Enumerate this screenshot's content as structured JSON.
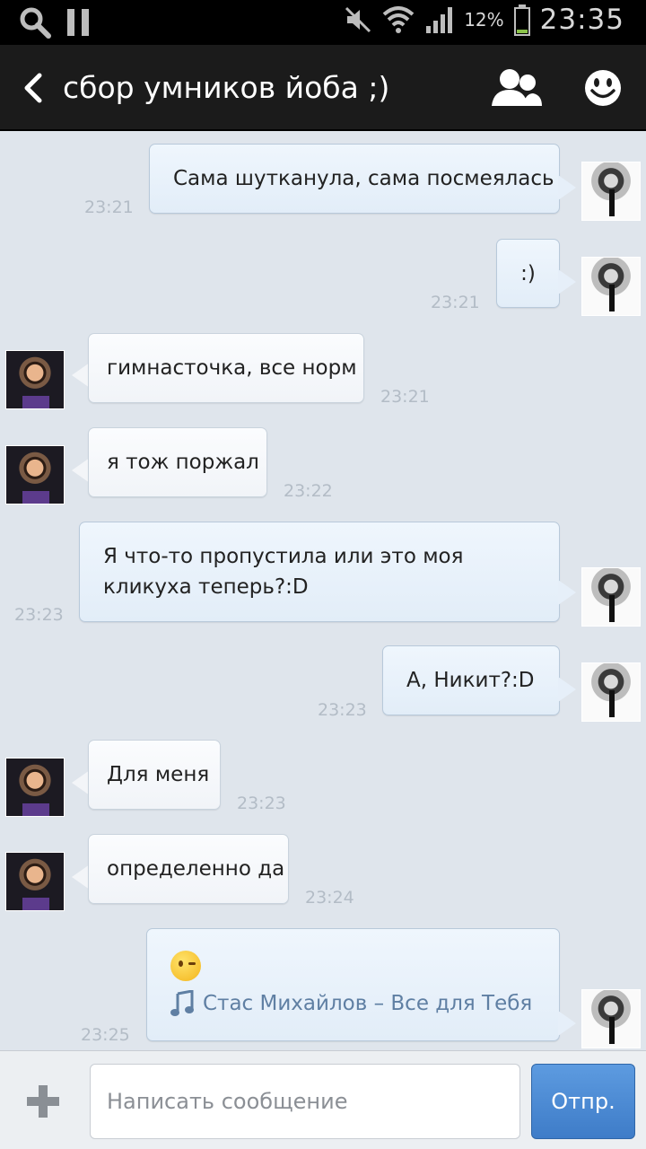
{
  "status_bar": {
    "battery_percent": "12%",
    "time": "23:35",
    "icons": [
      "search-icon",
      "pause-icon",
      "mute-icon",
      "wifi-icon",
      "signal-icon",
      "battery-icon"
    ]
  },
  "header": {
    "title": "сбор умников йоба ;)",
    "icons": [
      "back-icon",
      "members-icon",
      "smiley-icon"
    ]
  },
  "messages": [
    {
      "side": "out",
      "text": "Сама шутканула, сама посмеялась",
      "time": "23:21"
    },
    {
      "side": "out",
      "text": ":)",
      "time": "23:21"
    },
    {
      "side": "in",
      "text": "гимнасточка, все норм",
      "time": "23:21"
    },
    {
      "side": "in",
      "text": "я тож поржал",
      "time": "23:22"
    },
    {
      "side": "out",
      "lines": [
        "Я что-то пропустила или это моя",
        "кликуха теперь?:D"
      ],
      "time": "23:23"
    },
    {
      "side": "out",
      "text": "А, Никит?:D",
      "time": "23:23"
    },
    {
      "side": "in",
      "text": "Для меня",
      "time": "23:23"
    },
    {
      "side": "in",
      "text": "определенно да",
      "time": "23:24"
    },
    {
      "side": "out",
      "emoji": "wink-emoji",
      "music": "Стас Михайлов –  Все для Тебя",
      "time": "23:25"
    }
  ],
  "composer": {
    "placeholder": "Написать сообщение",
    "send_label": "Отпр."
  },
  "colors": {
    "background": "#dfe5ec",
    "header": "#1b1b1b",
    "send_button": "#4a88d4",
    "timestamp": "#b3bcc6"
  }
}
